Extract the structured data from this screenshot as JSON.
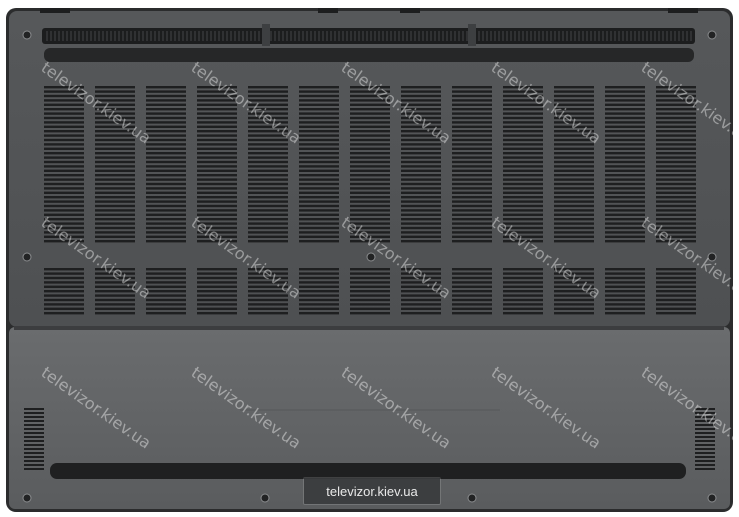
{
  "photo": {
    "subject": "laptop-bottom-panel",
    "colors": {
      "panel": "#5d5f61",
      "panel_dark": "#3a3c3e",
      "panel_lower": "#646668",
      "vent_slot": "#1e1f20",
      "edge": "#2a2b2c"
    }
  },
  "watermark": {
    "text": "televizor.kiev.ua"
  },
  "caption": {
    "text": "televizor.kiev.ua"
  }
}
